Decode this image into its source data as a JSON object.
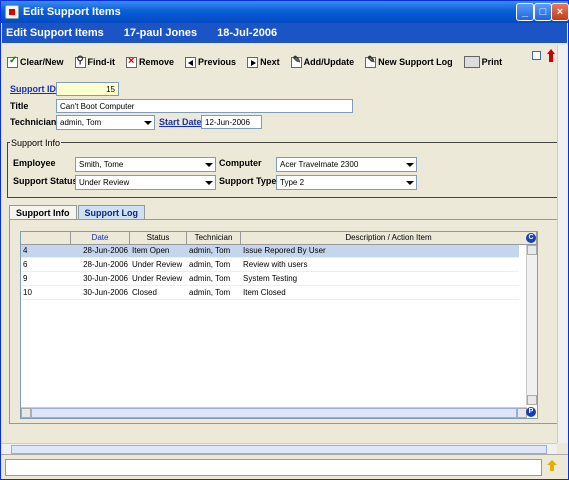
{
  "window": {
    "title": "Edit Support Items"
  },
  "header": {
    "title": "Edit Support Items",
    "record": "17-paul Jones",
    "date": "18-Jul-2006"
  },
  "toolbar": {
    "clear": "Clear/New",
    "find": "Find-it",
    "remove": "Remove",
    "previous": "Previous",
    "next": "Next",
    "add_update": "Add/Update",
    "new_log": "New Support Log",
    "print": "Print"
  },
  "form": {
    "support_id_label": "Support ID",
    "support_id": "15",
    "title_label": "Title",
    "title": "Can't Boot Computer",
    "technician_label": "Technician",
    "technician": "admin, Tom",
    "start_date_label": "Start Date",
    "start_date": "12-Jun-2006"
  },
  "support_info": {
    "group_title": "Support Info",
    "employee_label": "Employee",
    "employee": "Smith, Tome",
    "computer_label": "Computer",
    "computer": "Acer Travelmate 2300",
    "status_label": "Support Status",
    "status": "Under Review",
    "type_label": "Support Type",
    "type": "Type 2"
  },
  "tabs": [
    {
      "label": "Support Info"
    },
    {
      "label": "Support Log"
    }
  ],
  "log_table": {
    "columns": [
      "",
      "Date",
      "Status",
      "Technician",
      "Description / Action Item"
    ],
    "rows": [
      {
        "id": "4",
        "date": "28-Jun-2006",
        "status": "Item Open",
        "technician": "admin, Tom",
        "description": "Issue Repored By User"
      },
      {
        "id": "6",
        "date": "28-Jun-2006",
        "status": "Under Review",
        "technician": "admin, Tom",
        "description": "Review with users"
      },
      {
        "id": "9",
        "date": "30-Jun-2006",
        "status": "Under Review",
        "technician": "admin, Tom",
        "description": "System Testing"
      },
      {
        "id": "10",
        "date": "30-Jun-2006",
        "status": "Closed",
        "technician": "admin, Tom",
        "description": "Item Closed"
      }
    ],
    "corner_top": "C",
    "corner_bottom": "P"
  },
  "colors": {
    "title_bar": "#0a5fd8",
    "header": "#1b54c4",
    "link": "#1a2fb8",
    "selected_row": "#c6d5ee"
  }
}
